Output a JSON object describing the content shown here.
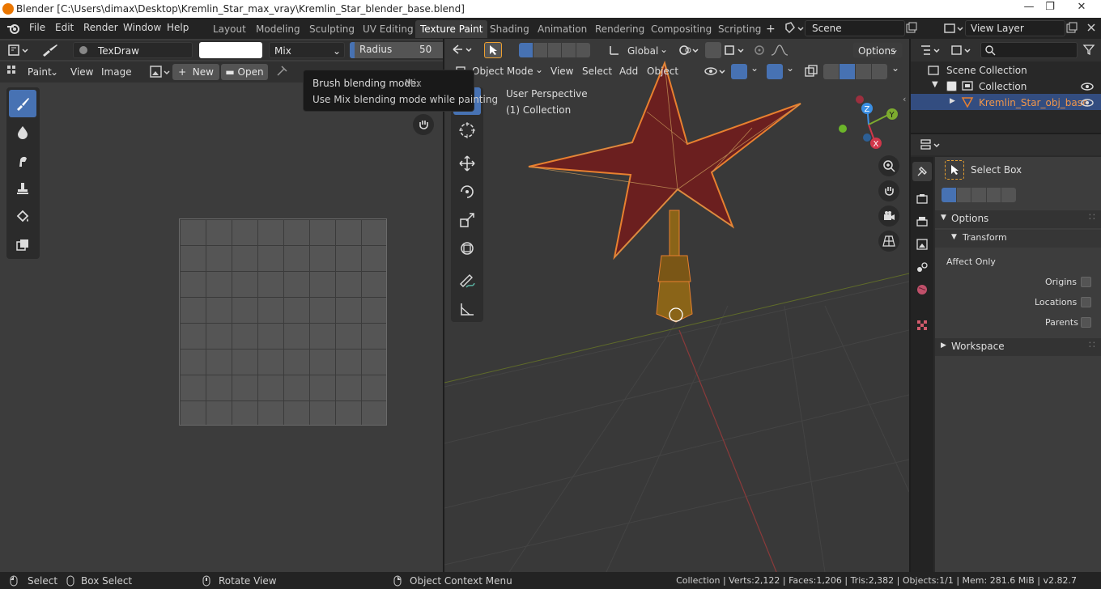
{
  "window": {
    "title": "Blender [C:\\Users\\dimax\\Desktop\\Kremlin_Star_max_vray\\Kremlin_Star_blender_base.blend]",
    "controls": [
      "—",
      "❐",
      "✕"
    ]
  },
  "menubar": {
    "items": [
      "File",
      "Edit",
      "Render",
      "Window",
      "Help"
    ]
  },
  "workspaces": {
    "tabs": [
      "Layout",
      "Modeling",
      "Sculpting",
      "UV Editing",
      "Texture Paint",
      "Shading",
      "Animation",
      "Rendering",
      "Compositing",
      "Scripting"
    ],
    "active": "Texture Paint",
    "add": "+"
  },
  "scene": {
    "name": "Scene"
  },
  "view_layer": {
    "name": "View Layer"
  },
  "image_editor": {
    "brush_name": "TexDraw",
    "brush_color": "#ffffff",
    "blend_mode": "Mix",
    "radius_label": "Radius",
    "radius_value": "50 px",
    "radius_fraction": 0.05,
    "mode": "Paint",
    "menu_view": "View",
    "menu_image": "Image",
    "new_label": "New",
    "open_label": "Open"
  },
  "tooltip": {
    "title": "Brush blending mode:",
    "value": "Mix",
    "description": "Use Mix blending mode while painting"
  },
  "viewport": {
    "mode": "Object Mode",
    "menus": [
      "View",
      "Select",
      "Add",
      "Object"
    ],
    "orientation": "Global",
    "options": "Options",
    "perspective": "User Perspective",
    "collection": "(1) Collection",
    "gizmo": {
      "x": "X",
      "y": "Y",
      "z": "Z"
    }
  },
  "outliner": {
    "scene_collection": "Scene Collection",
    "collection": "Collection",
    "object": "Kremlin_Star_obj_base"
  },
  "properties": {
    "tool_name": "Select Box",
    "options_label": "Options",
    "transform_label": "Transform",
    "affect_only": "Affect Only",
    "origins": "Origins",
    "locations": "Locations",
    "parents": "Parents",
    "workspace_label": "Workspace"
  },
  "statusbar": {
    "select": "Select",
    "box_select": "Box Select",
    "rotate_view": "Rotate View",
    "context_menu": "Object Context Menu",
    "stats": "Collection | Verts:2,122 | Faces:1,206 | Tris:2,382 | Objects:1/1 | Mem: 281.6 MiB | v2.82.7"
  },
  "colors": {
    "accent": "#4772b3",
    "object_highlight": "#e8802f",
    "star_red": "#6b1f1f",
    "active_tab": "#3d3d3d"
  }
}
